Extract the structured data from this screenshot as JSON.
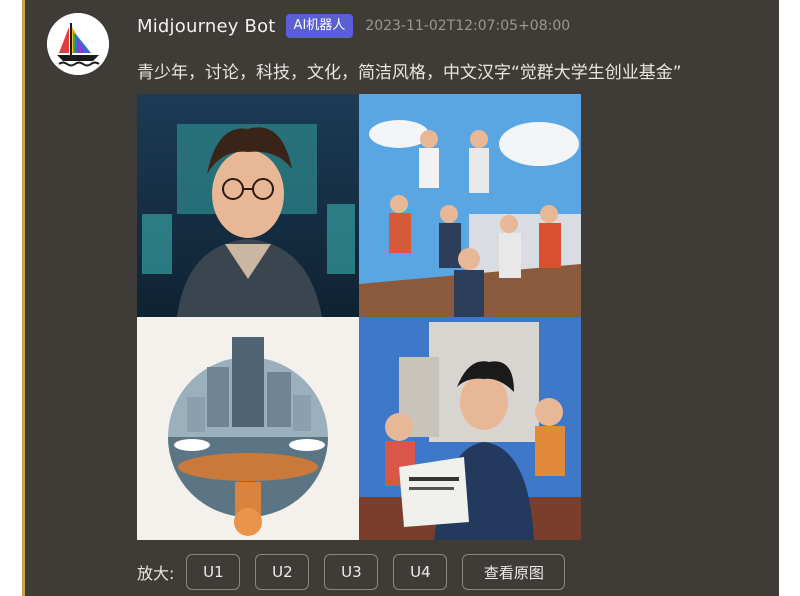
{
  "message": {
    "author": "Midjourney Bot",
    "badge": "AI机器人",
    "timestamp": "2023-11-02T12:07:05+08:00",
    "prompt": "青少年，讨论，科技，文化，简洁风格，中文汉字“觉群大学生创业基金”"
  },
  "images": [
    {
      "icon": "teen-portrait-image"
    },
    {
      "icon": "students-group-image"
    },
    {
      "icon": "tech-city-globe-image"
    },
    {
      "icon": "student-reading-image"
    }
  ],
  "actions": {
    "label": "放大:",
    "buttons": [
      "U1",
      "U2",
      "U3",
      "U4"
    ],
    "view_original": "查看原图"
  },
  "colors": {
    "panel_bg": "#3f3c38",
    "accent_border": "#c9a441",
    "badge_bg": "#5a5fd6"
  }
}
